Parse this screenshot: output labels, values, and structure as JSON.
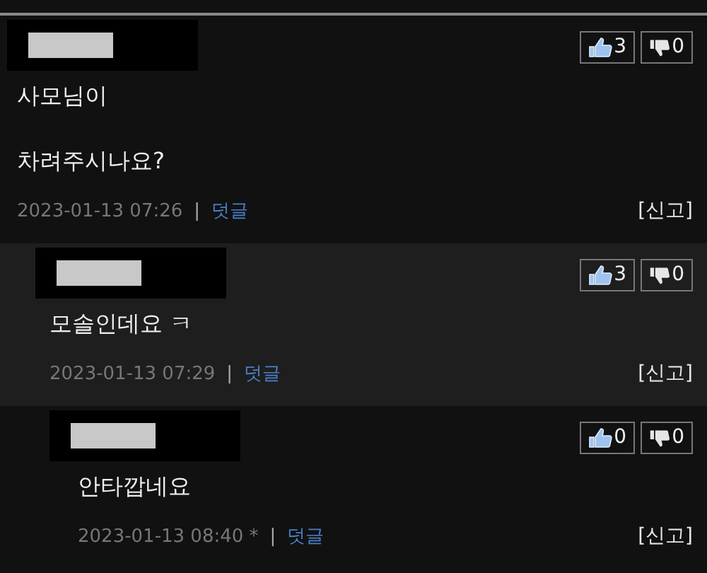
{
  "comments": [
    {
      "lines": [
        "사모님이",
        "차려주시나요?"
      ],
      "likes": "3",
      "dislikes": "0",
      "date": "2023-01-13 07:26",
      "separator": "|",
      "reply": "덧글",
      "report": "[신고]",
      "children": [
        {
          "lines": [
            "모솔인데요 ㅋ"
          ],
          "likes": "3",
          "dislikes": "0",
          "date": "2023-01-13 07:29",
          "separator": "|",
          "reply": "덧글",
          "report": "[신고]",
          "children": [
            {
              "lines": [
                "안타깝네요"
              ],
              "likes": "0",
              "dislikes": "0",
              "date": "2023-01-13 08:40 *",
              "separator": "|",
              "reply": "덧글",
              "report": "[신고]"
            }
          ]
        }
      ]
    }
  ]
}
